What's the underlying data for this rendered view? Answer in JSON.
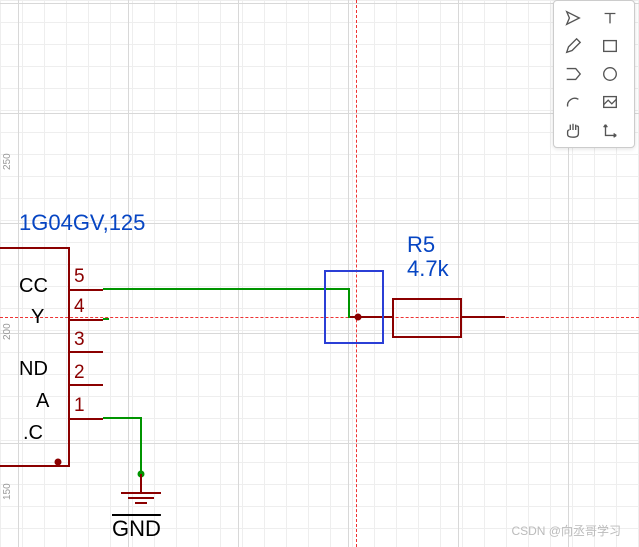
{
  "ruler": {
    "v1": "250",
    "v2": "200",
    "v3": "150"
  },
  "chip": {
    "partLabel": "1G04GV,125",
    "pins": [
      {
        "num": "1",
        "name": ".C"
      },
      {
        "num": "2",
        "name": "A"
      },
      {
        "num": "3",
        "name": "ND"
      },
      {
        "num": "4",
        "name": "Y"
      },
      {
        "num": "5",
        "name": "CC"
      }
    ]
  },
  "resistor": {
    "ref": "R5",
    "value": "4.7k"
  },
  "gnd": {
    "label": "GND"
  },
  "watermark": "CSDN @向丞哥学习",
  "tools": {
    "place": "place",
    "text": "text",
    "draw": "draw",
    "rect": "rect",
    "poly": "poly",
    "align": "align",
    "arc": "arc",
    "image": "image",
    "pan": "pan",
    "origin": "origin"
  }
}
